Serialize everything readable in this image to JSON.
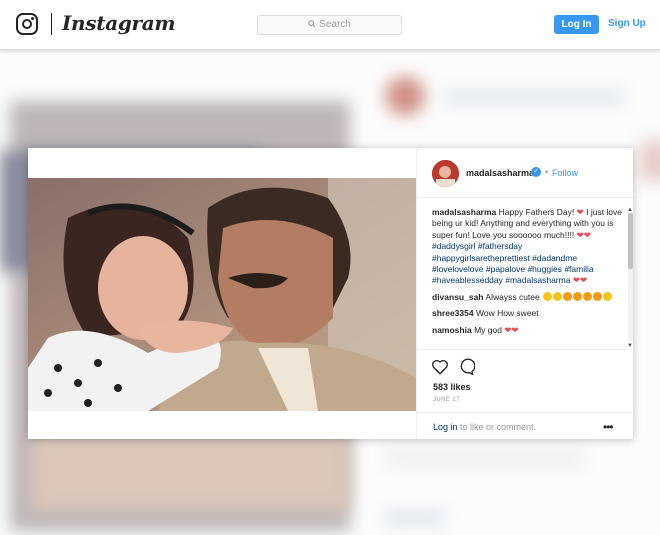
{
  "nav": {
    "brand": "Instagram",
    "search_placeholder": "Search",
    "login_label": "Log In",
    "signup_label": "Sign Up"
  },
  "post": {
    "username": "madalsasharma",
    "dot": "•",
    "follow_label": "Follow",
    "likes": "583 likes",
    "date": "JUNE 17",
    "login_link": "Log in",
    "login_text": " to like or comment.",
    "more": "•••"
  },
  "caption": {
    "author": "madalsasharma",
    "text1": "Happy Fathers Day!",
    "text2": "I just love being ur kid! Anything and everything with you is super fun! Love you soooooo much!!!!",
    "tag1": "#daddysgirl",
    "tags": "#fathersday #happygirlsaretheprettiest #dadandme #lovelovelove #papalove #huggies #familia #haveablessedday #madalsasharma"
  },
  "comments": [
    {
      "user": "divansu_sah",
      "text": "Alwayss cutee"
    },
    {
      "user": "shree3354",
      "text": "Wow How sweet"
    },
    {
      "user": "namoshia",
      "text": "My god"
    }
  ],
  "icons": [
    "instagram-logo-icon",
    "search-icon",
    "verified-badge-icon",
    "heart-icon",
    "comment-icon",
    "more-options-icon"
  ],
  "colors": {
    "accent": "#3897f0",
    "heart": "#ed4956",
    "link": "#003569"
  }
}
